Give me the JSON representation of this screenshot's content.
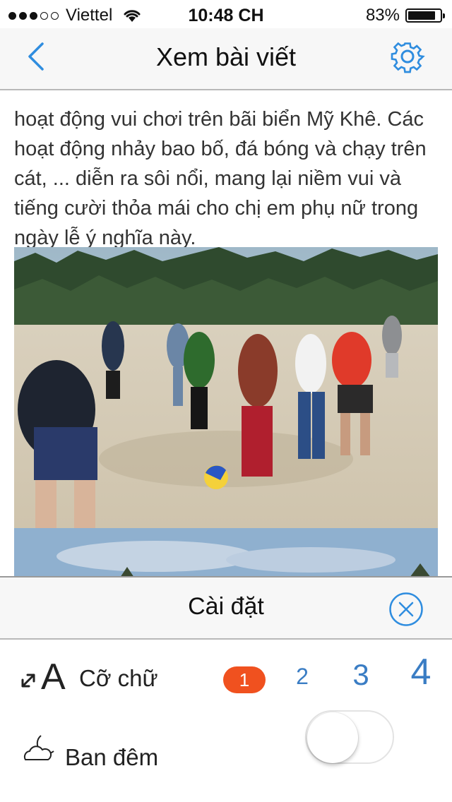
{
  "status_bar": {
    "carrier": "Viettel",
    "time": "10:48 CH",
    "battery_percent": "83%",
    "signal_bars": 3,
    "signal_total": 5
  },
  "navbar": {
    "back_icon": "chevron-left-icon",
    "title": "Xem bài viết",
    "settings_icon": "gear-icon"
  },
  "article": {
    "text": "hoạt động vui chơi trên bãi biển Mỹ Khê. Các hoạt động nhảy bao bố, đá bóng và chạy trên cát, ... diễn ra sôi nổi, mang lại niềm vui và tiếng cười thỏa mái cho chị em phụ nữ trong ngày lễ ý nghĩa này."
  },
  "settings": {
    "title": "Cài đặt",
    "close_icon": "close-circle-icon",
    "font_size": {
      "label": "Cỡ chữ",
      "options": [
        "1",
        "2",
        "3",
        "4"
      ],
      "selected": "1"
    },
    "night_mode": {
      "label": "Ban đêm",
      "enabled": false
    }
  },
  "colors": {
    "accent": "#3a7dc4",
    "selected_size": "#f0511f",
    "nav_blue": "#2f8ddf"
  }
}
